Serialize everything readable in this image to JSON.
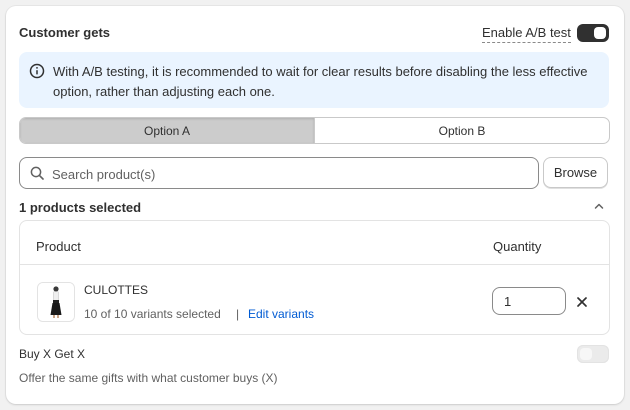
{
  "section": {
    "title": "Customer gets",
    "ab_test_label": "Enable A/B test",
    "ab_test_enabled": true
  },
  "banner": {
    "text": "With A/B testing, it is recommended to wait for clear results before disabling the less effective option, rather than adjusting each one.",
    "icon": "info-icon"
  },
  "options": {
    "tabs": [
      "Option A",
      "Option B"
    ],
    "active": 0
  },
  "search": {
    "placeholder": "Search product(s)",
    "value": "",
    "browse_label": "Browse"
  },
  "selection": {
    "count_text": "1 products selected"
  },
  "table": {
    "columns": [
      "Product",
      "Quantity"
    ],
    "rows": [
      {
        "name": "CULOTTES",
        "variants_text": "10 of 10 variants selected",
        "separator": "|",
        "edit_label": "Edit variants",
        "quantity": "1"
      }
    ]
  },
  "bxgx": {
    "title": "Buy X Get X",
    "description": "Offer the same gifts with what customer buys (X)",
    "enabled": false
  },
  "colors": {
    "banner_bg": "#eaf4ff",
    "link": "#005bd3",
    "toggle_on": "#303030",
    "toggle_off": "#ebebeb"
  }
}
